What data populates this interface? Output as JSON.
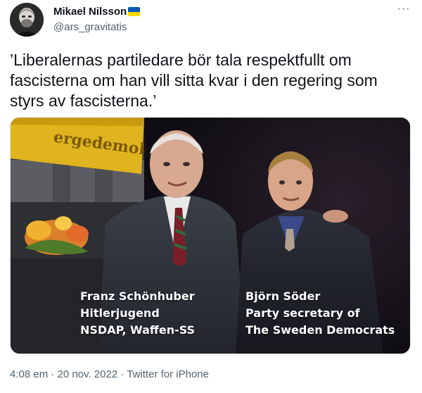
{
  "author": {
    "name": "Mikael Nilsson",
    "handle": "@ars_gravitatis",
    "flag_colors": [
      "#0057b7",
      "#ffd700"
    ]
  },
  "menu": {
    "more_icon": "more-horizontal-icon",
    "more_label": "···"
  },
  "tweet": {
    "text": "’Liberalernas partiledare bör tala respektfullt om fascisterna om han vill sitta kvar i den regering som styrs av fascisterna.’"
  },
  "media": {
    "banner_text": "ergedemokrat",
    "caption_left": [
      "Franz Schönhuber",
      "Hitlerjugend",
      "NSDAP, Waffen-SS"
    ],
    "caption_right": [
      "Björn Söder",
      "Party secretary  of",
      "The Sweden Democrats"
    ]
  },
  "meta": {
    "time": "4:08 em",
    "separator": "·",
    "date": "20 nov. 2022",
    "source": "Twitter for iPhone"
  },
  "colors": {
    "text_primary": "#0f1419",
    "text_secondary": "#536471",
    "banner_yellow": "#e0b41e"
  }
}
